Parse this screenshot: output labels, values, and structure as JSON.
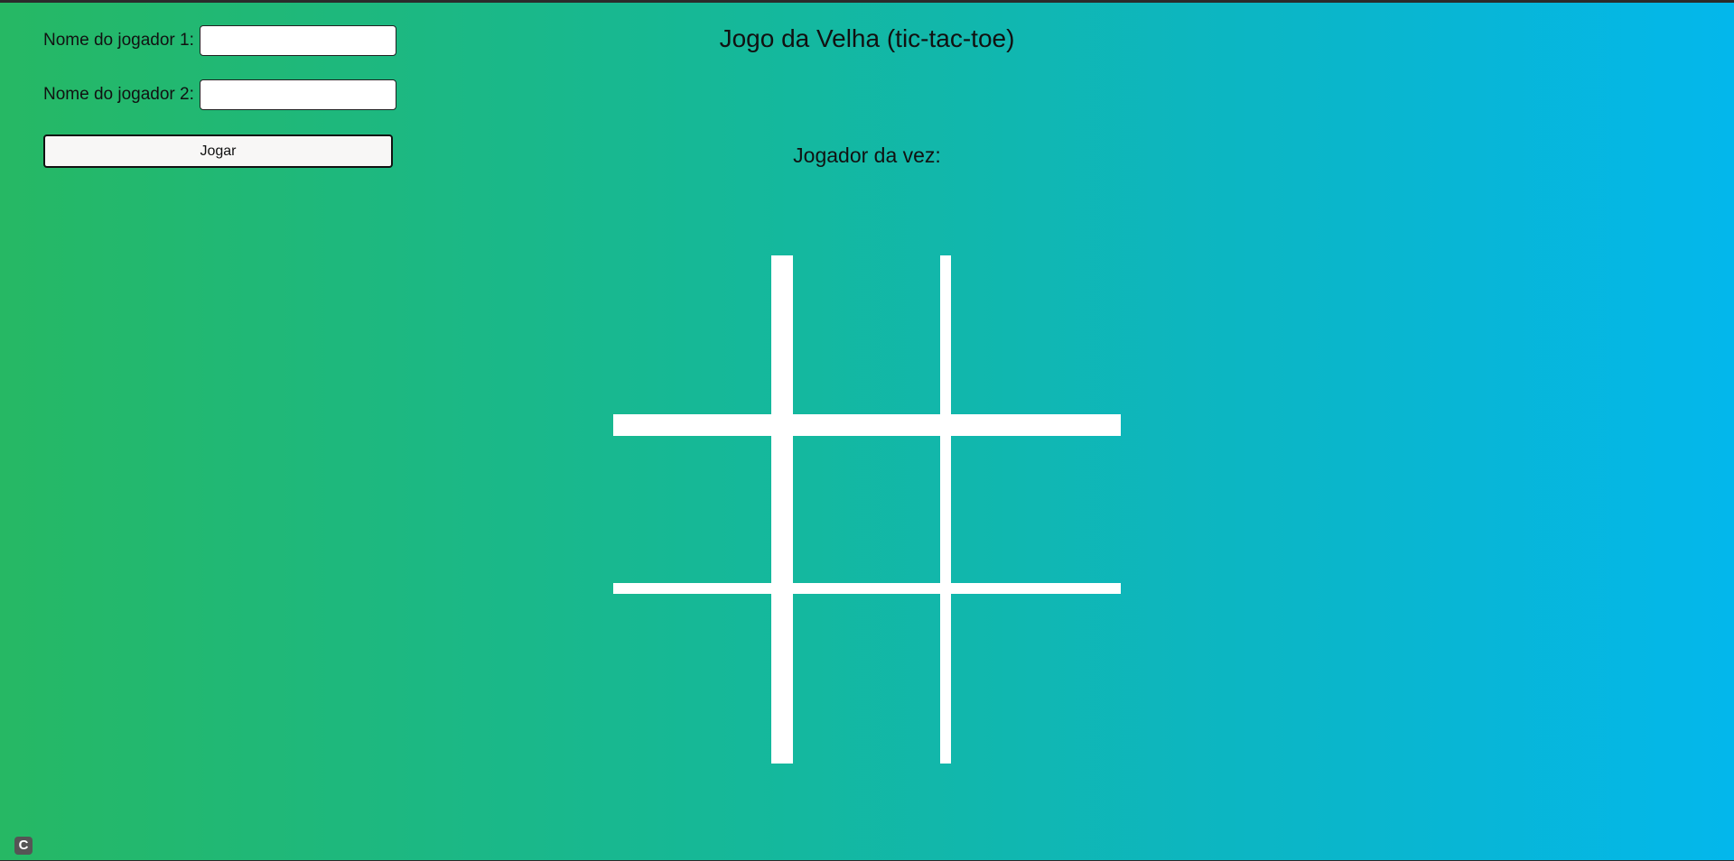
{
  "form": {
    "player1_label": "Nome do jogador 1:",
    "player1_value": "",
    "player2_label": "Nome do jogador 2:",
    "player2_value": "",
    "play_button": "Jogar"
  },
  "header": {
    "title": "Jogo da Velha (tic-tac-toe)",
    "turn_label": "Jogador da vez:"
  },
  "board": {
    "cells": [
      "",
      "",
      "",
      "",
      "",
      "",
      "",
      "",
      ""
    ]
  },
  "corner_badge": {
    "icon": "c-logo-icon",
    "text": "C"
  }
}
